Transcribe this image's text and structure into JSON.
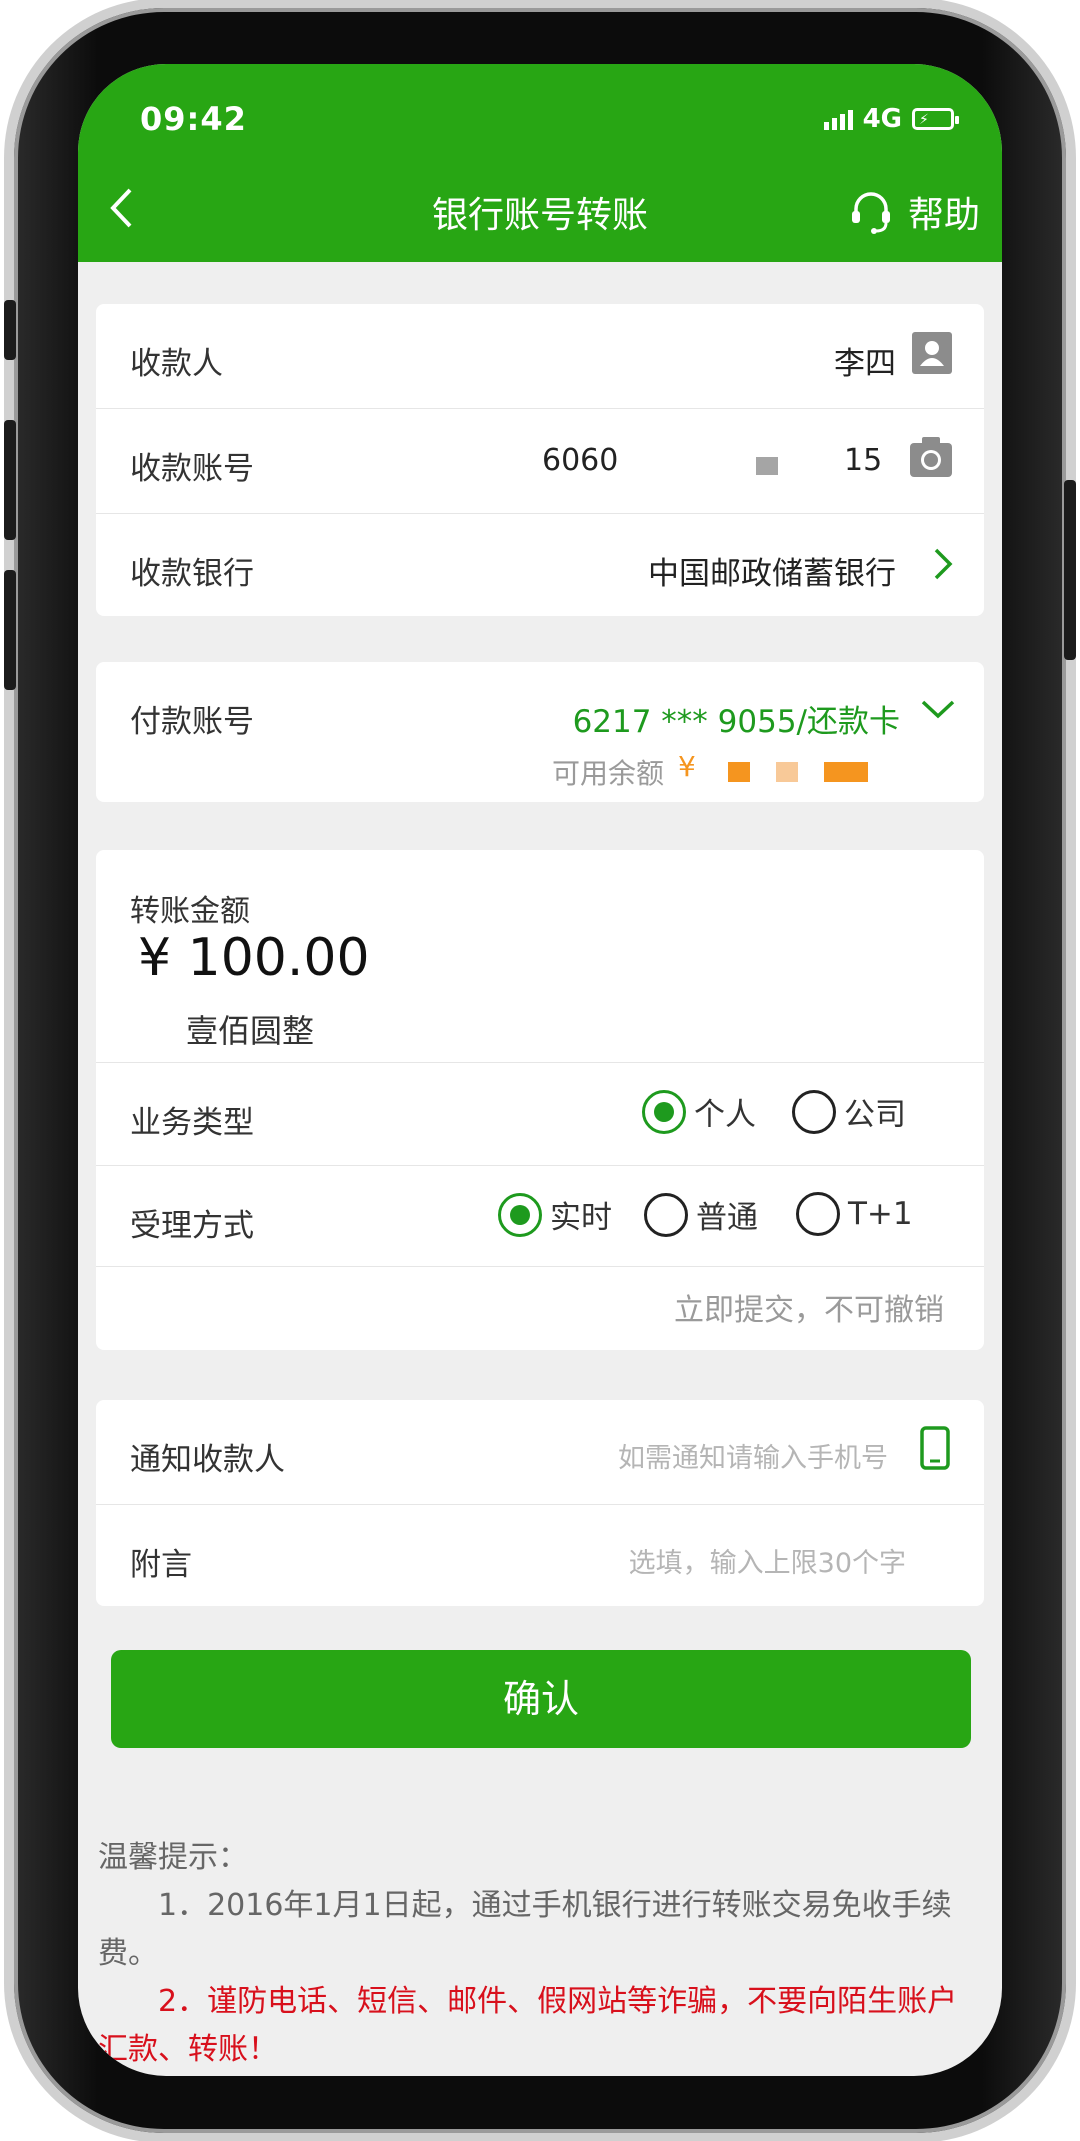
{
  "status": {
    "time": "09:42",
    "network": "4G"
  },
  "nav": {
    "title": "银行账号转账",
    "help": "帮助"
  },
  "payee": {
    "name_label": "收款人",
    "name_value": "李四",
    "account_label": "收款账号",
    "account_prefix": "6060",
    "account_suffix": "15",
    "bank_label": "收款银行",
    "bank_value": "中国邮政储蓄银行"
  },
  "payer": {
    "label": "付款账号",
    "account": "6217 *** 9055/还款卡",
    "balance_label": "可用余额",
    "currency": "¥"
  },
  "amount": {
    "label": "转账金额",
    "value": "¥ 100.00",
    "words": "壹佰圆整",
    "business_label": "业务类型",
    "business_options": [
      "个人",
      "公司"
    ],
    "business_selected": "个人",
    "mode_label": "受理方式",
    "mode_options": [
      "实时",
      "普通",
      "T+1"
    ],
    "mode_selected": "实时",
    "mode_note": "立即提交，不可撤销"
  },
  "notify": {
    "label": "通知收款人",
    "placeholder": "如需通知请输入手机号",
    "note_label": "附言",
    "note_placeholder": "选填，输入上限30个字"
  },
  "confirm": {
    "label": "确认"
  },
  "tips": {
    "title": "温馨提示：",
    "item1": "1．2016年1月1日起，通过手机银行进行转账交易免收手续费。",
    "item2": "2．谨防电话、短信、邮件、假网站等诈骗，不要向陌生账户汇款、转账！"
  },
  "colors": {
    "brand": "#28a614",
    "accent_green": "#1e9a1e",
    "warning": "#d8101c",
    "balance_mask": "#f5951f"
  }
}
